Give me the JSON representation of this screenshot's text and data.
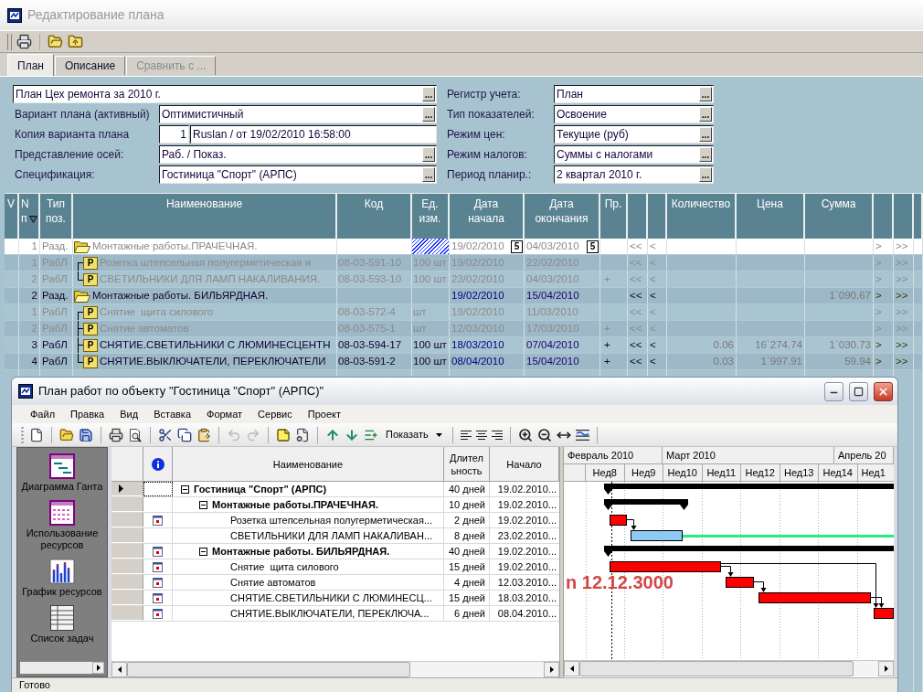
{
  "window": {
    "title": "Редактирование плана"
  },
  "tabs": [
    {
      "label": "План",
      "selected": true,
      "disabled": false
    },
    {
      "label": "Описание",
      "selected": false,
      "disabled": false
    },
    {
      "label": "Сравнить с ...",
      "selected": false,
      "disabled": true
    }
  ],
  "form": {
    "left": [
      {
        "kind": "full",
        "value": "План Цех ремонта за 2010 г.",
        "button": "..."
      },
      {
        "kind": "lookup",
        "label": "Вариант плана (активный)",
        "value": "Оптимистичный",
        "button": "..."
      },
      {
        "kind": "pair",
        "label": "Копия варианта плана",
        "number": "1",
        "value": "Ruslan / от 19/02/2010 16:58:00"
      },
      {
        "kind": "lookup",
        "label": "Представление осей:",
        "value": "Раб. / Показ.",
        "button": "..."
      },
      {
        "kind": "lookup",
        "label": "Спецификация:",
        "value": "Гостиница \"Спорт\" (АРПС)",
        "button": "..."
      }
    ],
    "right": [
      {
        "label": "Регистр учета:",
        "value": "План",
        "button": "..."
      },
      {
        "label": "Тип показателей:",
        "value": "Освоение",
        "button": "..."
      },
      {
        "label": "Режим цен:",
        "value": "Текущие (руб)",
        "button": "..."
      },
      {
        "label": "Режим налогов:",
        "value": "Суммы с налогами",
        "button": "..."
      },
      {
        "label": "Период планир.:",
        "value": "2 квартал 2010 г.",
        "button": "..."
      }
    ]
  },
  "table": {
    "columns": [
      {
        "kind": "text",
        "label": "V"
      },
      {
        "kind": "sorted",
        "label": "N\nп"
      },
      {
        "kind": "text",
        "label": "Тип\nпоз."
      },
      {
        "kind": "text",
        "label": "Наименование"
      },
      {
        "kind": "text",
        "label": "Код"
      },
      {
        "kind": "text",
        "label": "Ед.\nизм."
      },
      {
        "kind": "text",
        "label": "Дата\nначала"
      },
      {
        "kind": "text",
        "label": "Дата\nокончания"
      },
      {
        "kind": "text",
        "label": "Пр."
      },
      {
        "kind": "blank"
      },
      {
        "kind": "blank"
      },
      {
        "kind": "text",
        "label": "Количество"
      },
      {
        "kind": "text",
        "label": "Цена"
      },
      {
        "kind": "text",
        "label": "Сумма"
      },
      {
        "kind": "blank"
      },
      {
        "kind": "blank"
      },
      {
        "kind": "blank"
      }
    ],
    "rows": [
      {
        "kind": "section",
        "n": "1",
        "type": "Разд.",
        "name": "Монтажные работы.ПРАЧЕЧНАЯ.",
        "unit_hatched": true,
        "start": "19/02/2010",
        "start_picker": "5",
        "end": "04/03/2010",
        "end_picker": "5",
        "col_10": "<<",
        "col_11": "<",
        "col_15": ">",
        "col_16": ">>",
        "selected": true,
        "dimmed": true,
        "children": [
          {
            "kind": "work",
            "n": "1",
            "type": "РабЛ",
            "badge": "P",
            "name": "Розетка штепсельная полугерметическая и",
            "code": "08-03-591-10",
            "unit": "100 шт",
            "unit_hatched": false,
            "start": "19/02/2010",
            "end": "22/02/2010",
            "col_10": "<<",
            "col_11": "<",
            "col_15": ">",
            "col_16": ">>",
            "selected": false,
            "dimmed": true
          },
          {
            "kind": "work",
            "n": "2",
            "type": "РабЛ",
            "badge": "P",
            "name": "СВЕТИЛЬНИКИ ДЛЯ ЛАМП НАКАЛИВАНИЯ.",
            "code": "08-03-593-10",
            "unit": "100 шт",
            "unit_hatched": false,
            "start": "23/02/2010",
            "end": "04/03/2010",
            "pr": "+",
            "col_10": "<<",
            "col_11": "<",
            "col_15": ">",
            "col_16": ">>",
            "selected": false,
            "dimmed": true
          }
        ]
      },
      {
        "kind": "section",
        "n": "2",
        "type": "Разд.",
        "name": "Монтажные работы. БИЛЬЯРДНАЯ.",
        "unit_hatched": false,
        "start": "19/02/2010",
        "end": "15/04/2010",
        "sum": "1`090.67",
        "col_10": "<<",
        "col_11": "<",
        "col_15": ">",
        "col_16": ">>",
        "selected": false,
        "dimmed": false,
        "children": [
          {
            "kind": "work",
            "n": "1",
            "type": "РабЛ",
            "badge": "P",
            "name": "Снятие  щита силового",
            "code": "08-03-572-4",
            "unit": "шт",
            "unit_hatched": false,
            "start": "19/02/2010",
            "end": "11/03/2010",
            "col_10": "<<",
            "col_11": "<",
            "col_15": ">",
            "col_16": ">>",
            "selected": false,
            "dimmed": true
          },
          {
            "kind": "work",
            "n": "2",
            "type": "РабЛ",
            "badge": "P",
            "name": "Снятие автоматов",
            "code": "08-03-575-1",
            "unit": "шт",
            "unit_hatched": false,
            "start": "12/03/2010",
            "end": "17/03/2010",
            "pr": "+",
            "col_10": "<<",
            "col_11": "<",
            "col_15": ">",
            "col_16": ">>",
            "selected": false,
            "dimmed": true
          },
          {
            "kind": "work",
            "n": "3",
            "type": "РабЛ",
            "badge": "P",
            "name": "СНЯТИЕ.СВЕТИЛЬНИКИ С ЛЮМИНЕСЦЕНТН",
            "code": "08-03-594-17",
            "unit": "100 шт",
            "unit_hatched": false,
            "start": "18/03/2010",
            "end": "07/04/2010",
            "pr": "+",
            "col_10": "<<",
            "col_11": "<",
            "qty": "0.06",
            "price": "16`274.74",
            "sum": "1`030.73",
            "col_15": ">",
            "col_16": ">>",
            "selected": false,
            "dimmed": false
          },
          {
            "kind": "work",
            "n": "4",
            "type": "РабЛ",
            "badge": "P",
            "name": "СНЯТИЕ.ВЫКЛЮЧАТЕЛИ, ПЕРЕКЛЮЧАТЕЛИ",
            "code": "08-03-591-2",
            "unit": "100 шт",
            "unit_hatched": false,
            "start": "08/04/2010",
            "end": "15/04/2010",
            "pr": "+",
            "col_10": "<<",
            "col_11": "<",
            "qty": "0.03",
            "price": "1`997.91",
            "sum": "59.94",
            "col_15": ">",
            "col_16": ">>",
            "selected": false,
            "dimmed": false
          }
        ]
      }
    ]
  },
  "plan_window": {
    "title": "План работ по объекту \"Гостиница \"Спорт\" (АРПС)\"",
    "menu": [
      "Файл",
      "Правка",
      "Вид",
      "Вставка",
      "Формат",
      "Сервис",
      "Проект"
    ],
    "show_button": "Показать",
    "views": [
      {
        "kind": "gantt",
        "label": "Диаграмма Ганта"
      },
      {
        "kind": "usage",
        "label": "Использование ресурсов"
      },
      {
        "kind": "graph",
        "label": "График ресурсов"
      },
      {
        "kind": "sheet",
        "label": "Список задач"
      }
    ],
    "grid": {
      "columns": [
        {
          "kind": "blank"
        },
        {
          "kind": "info"
        },
        {
          "kind": "text",
          "label": "Наименование"
        },
        {
          "kind": "text",
          "label": "Длител\nьность"
        },
        {
          "kind": "text",
          "label": "Начало"
        }
      ],
      "tasks": [
        {
          "kind": "summary",
          "name": "Гостиница \"Спорт\" (АРПС)",
          "duration": "40 дней",
          "start": "19.02.2010...",
          "expanded": true,
          "indicator": false,
          "selected": true,
          "children": [
            {
              "kind": "summary",
              "name": "Монтажные работы.ПРАЧЕЧНАЯ.",
              "duration": "10 дней",
              "start": "19.02.2010...",
              "expanded": true,
              "indicator": false,
              "selected": false,
              "children": [
                {
                  "kind": "task",
                  "name": "Розетка штепсельная полугерметическая...",
                  "duration": "2 дней",
                  "start": "19.02.2010...",
                  "indicator": true,
                  "selected": false
                },
                {
                  "kind": "task",
                  "name": "СВЕТИЛЬНИКИ ДЛЯ ЛАМП НАКАЛИВАН...",
                  "duration": "8 дней",
                  "start": "23.02.2010...",
                  "indicator": false,
                  "selected": false
                }
              ]
            },
            {
              "kind": "summary",
              "name": "Монтажные работы. БИЛЬЯРДНАЯ.",
              "duration": "40 дней",
              "start": "19.02.2010...",
              "expanded": true,
              "indicator": true,
              "selected": false,
              "children": [
                {
                  "kind": "task",
                  "name": "Снятие  щита силового",
                  "duration": "15 дней",
                  "start": "19.02.2010...",
                  "indicator": true,
                  "selected": false
                },
                {
                  "kind": "task",
                  "name": "Снятие автоматов",
                  "duration": "4 дней",
                  "start": "12.03.2010...",
                  "indicator": true,
                  "selected": false
                },
                {
                  "kind": "task",
                  "name": "СНЯТИЕ.СВЕТИЛЬНИКИ С ЛЮМИНЕСЦ...",
                  "duration": "15 дней",
                  "start": "18.03.2010...",
                  "indicator": true,
                  "selected": false
                },
                {
                  "kind": "task",
                  "name": "СНЯТИЕ.ВЫКЛЮЧАТЕЛИ, ПЕРЕКЛЮЧА...",
                  "duration": "6 дней",
                  "start": "08.04.2010...",
                  "indicator": true,
                  "selected": false
                }
              ]
            }
          ]
        }
      ]
    },
    "gantt": {
      "months": [
        "Февраль 2010",
        "Март 2010",
        "Апрель 20"
      ],
      "weeks": [
        "Нед8",
        "Нед9",
        "Нед10",
        "Нед11",
        "Нед12",
        "Нед13",
        "Нед14",
        "Нед1"
      ],
      "notice": "n 12.12.3000"
    },
    "status": "Готово"
  }
}
